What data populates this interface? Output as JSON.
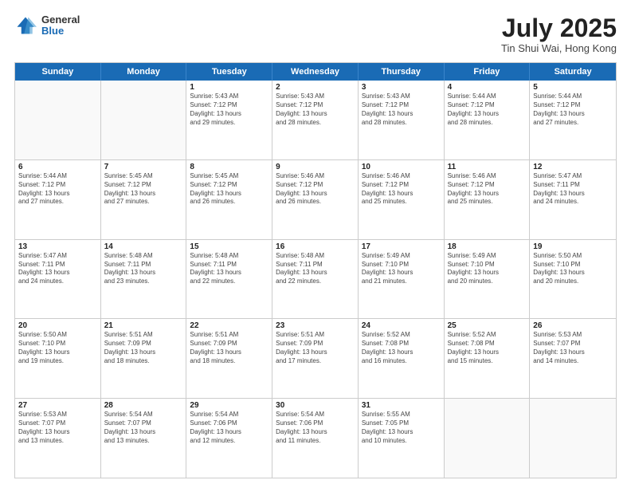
{
  "logo": {
    "general": "General",
    "blue": "Blue"
  },
  "header": {
    "month": "July 2025",
    "location": "Tin Shui Wai, Hong Kong"
  },
  "weekdays": [
    "Sunday",
    "Monday",
    "Tuesday",
    "Wednesday",
    "Thursday",
    "Friday",
    "Saturday"
  ],
  "rows": [
    [
      {
        "day": "",
        "info": "",
        "empty": true
      },
      {
        "day": "",
        "info": "",
        "empty": true
      },
      {
        "day": "1",
        "info": "Sunrise: 5:43 AM\nSunset: 7:12 PM\nDaylight: 13 hours\nand 29 minutes."
      },
      {
        "day": "2",
        "info": "Sunrise: 5:43 AM\nSunset: 7:12 PM\nDaylight: 13 hours\nand 28 minutes."
      },
      {
        "day": "3",
        "info": "Sunrise: 5:43 AM\nSunset: 7:12 PM\nDaylight: 13 hours\nand 28 minutes."
      },
      {
        "day": "4",
        "info": "Sunrise: 5:44 AM\nSunset: 7:12 PM\nDaylight: 13 hours\nand 28 minutes."
      },
      {
        "day": "5",
        "info": "Sunrise: 5:44 AM\nSunset: 7:12 PM\nDaylight: 13 hours\nand 27 minutes."
      }
    ],
    [
      {
        "day": "6",
        "info": "Sunrise: 5:44 AM\nSunset: 7:12 PM\nDaylight: 13 hours\nand 27 minutes."
      },
      {
        "day": "7",
        "info": "Sunrise: 5:45 AM\nSunset: 7:12 PM\nDaylight: 13 hours\nand 27 minutes."
      },
      {
        "day": "8",
        "info": "Sunrise: 5:45 AM\nSunset: 7:12 PM\nDaylight: 13 hours\nand 26 minutes."
      },
      {
        "day": "9",
        "info": "Sunrise: 5:46 AM\nSunset: 7:12 PM\nDaylight: 13 hours\nand 26 minutes."
      },
      {
        "day": "10",
        "info": "Sunrise: 5:46 AM\nSunset: 7:12 PM\nDaylight: 13 hours\nand 25 minutes."
      },
      {
        "day": "11",
        "info": "Sunrise: 5:46 AM\nSunset: 7:12 PM\nDaylight: 13 hours\nand 25 minutes."
      },
      {
        "day": "12",
        "info": "Sunrise: 5:47 AM\nSunset: 7:11 PM\nDaylight: 13 hours\nand 24 minutes."
      }
    ],
    [
      {
        "day": "13",
        "info": "Sunrise: 5:47 AM\nSunset: 7:11 PM\nDaylight: 13 hours\nand 24 minutes."
      },
      {
        "day": "14",
        "info": "Sunrise: 5:48 AM\nSunset: 7:11 PM\nDaylight: 13 hours\nand 23 minutes."
      },
      {
        "day": "15",
        "info": "Sunrise: 5:48 AM\nSunset: 7:11 PM\nDaylight: 13 hours\nand 22 minutes."
      },
      {
        "day": "16",
        "info": "Sunrise: 5:48 AM\nSunset: 7:11 PM\nDaylight: 13 hours\nand 22 minutes."
      },
      {
        "day": "17",
        "info": "Sunrise: 5:49 AM\nSunset: 7:10 PM\nDaylight: 13 hours\nand 21 minutes."
      },
      {
        "day": "18",
        "info": "Sunrise: 5:49 AM\nSunset: 7:10 PM\nDaylight: 13 hours\nand 20 minutes."
      },
      {
        "day": "19",
        "info": "Sunrise: 5:50 AM\nSunset: 7:10 PM\nDaylight: 13 hours\nand 20 minutes."
      }
    ],
    [
      {
        "day": "20",
        "info": "Sunrise: 5:50 AM\nSunset: 7:10 PM\nDaylight: 13 hours\nand 19 minutes."
      },
      {
        "day": "21",
        "info": "Sunrise: 5:51 AM\nSunset: 7:09 PM\nDaylight: 13 hours\nand 18 minutes."
      },
      {
        "day": "22",
        "info": "Sunrise: 5:51 AM\nSunset: 7:09 PM\nDaylight: 13 hours\nand 18 minutes."
      },
      {
        "day": "23",
        "info": "Sunrise: 5:51 AM\nSunset: 7:09 PM\nDaylight: 13 hours\nand 17 minutes."
      },
      {
        "day": "24",
        "info": "Sunrise: 5:52 AM\nSunset: 7:08 PM\nDaylight: 13 hours\nand 16 minutes."
      },
      {
        "day": "25",
        "info": "Sunrise: 5:52 AM\nSunset: 7:08 PM\nDaylight: 13 hours\nand 15 minutes."
      },
      {
        "day": "26",
        "info": "Sunrise: 5:53 AM\nSunset: 7:07 PM\nDaylight: 13 hours\nand 14 minutes."
      }
    ],
    [
      {
        "day": "27",
        "info": "Sunrise: 5:53 AM\nSunset: 7:07 PM\nDaylight: 13 hours\nand 13 minutes."
      },
      {
        "day": "28",
        "info": "Sunrise: 5:54 AM\nSunset: 7:07 PM\nDaylight: 13 hours\nand 13 minutes."
      },
      {
        "day": "29",
        "info": "Sunrise: 5:54 AM\nSunset: 7:06 PM\nDaylight: 13 hours\nand 12 minutes."
      },
      {
        "day": "30",
        "info": "Sunrise: 5:54 AM\nSunset: 7:06 PM\nDaylight: 13 hours\nand 11 minutes."
      },
      {
        "day": "31",
        "info": "Sunrise: 5:55 AM\nSunset: 7:05 PM\nDaylight: 13 hours\nand 10 minutes."
      },
      {
        "day": "",
        "info": "",
        "empty": true
      },
      {
        "day": "",
        "info": "",
        "empty": true
      }
    ]
  ]
}
